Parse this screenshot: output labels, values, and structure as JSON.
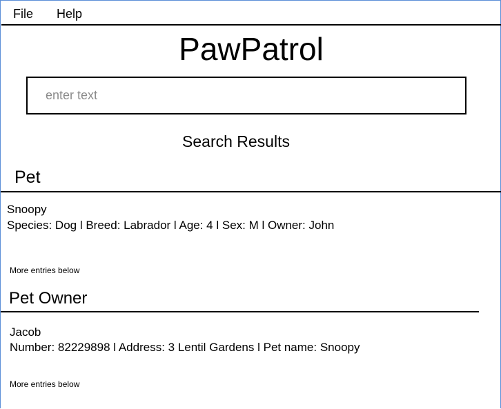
{
  "menu": {
    "file": "File",
    "help": "Help"
  },
  "app": {
    "title": "PawPatrol"
  },
  "search": {
    "placeholder": "enter text",
    "value": ""
  },
  "results": {
    "heading": "Search Results",
    "pet_section": {
      "title": "Pet",
      "entry_name": "Snoopy",
      "entry_details": "Species: Dog  l  Breed: Labrador  l  Age: 4  l  Sex: M  l  Owner: John",
      "more_note": "More entries below"
    },
    "owner_section": {
      "title": "Pet Owner",
      "entry_name": "Jacob",
      "entry_details": "Number: 82229898  l  Address: 3 Lentil Gardens  l  Pet name: Snoopy",
      "more_note": "More entries below"
    }
  }
}
